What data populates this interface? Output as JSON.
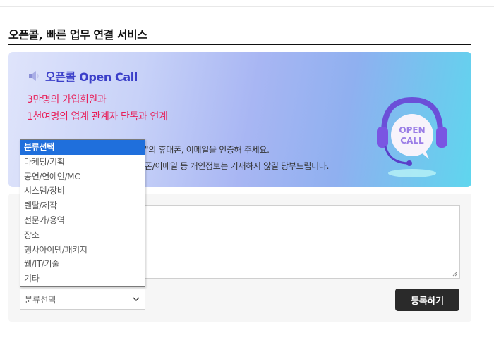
{
  "section": {
    "title": "오픈콜, 빠른 업무 연결 서비스"
  },
  "banner": {
    "brand": "오픈콜 Open Call",
    "tagline_1": "3만명의 가입회원과",
    "tagline_2": "1천여명의 업계 관계자 단톡과 연계",
    "notice_1": "\"의 휴대폰, 이메일을 인증해 주세요.",
    "notice_2": "폰/이메일 등 개인정보는 기재하지 않길 당부드립니다.",
    "badge_line_1": "OPEN",
    "badge_line_2": "CALL"
  },
  "form": {
    "category_selected": "분류선택",
    "submit_label": "등록하기"
  },
  "dropdown": {
    "options": [
      "분류선택",
      "마케팅/기획",
      "공연/연예인/MC",
      "시스템/장비",
      "렌탈/제작",
      "전문가/용역",
      "장소",
      "행사아이템/패키지",
      "웹/IT/기술",
      "기타"
    ]
  },
  "colors": {
    "brand": "#3b3fc9",
    "tagline": "#e8205a",
    "selected_option": "#1f6fdc",
    "submit_bg": "#2a2a2a"
  }
}
